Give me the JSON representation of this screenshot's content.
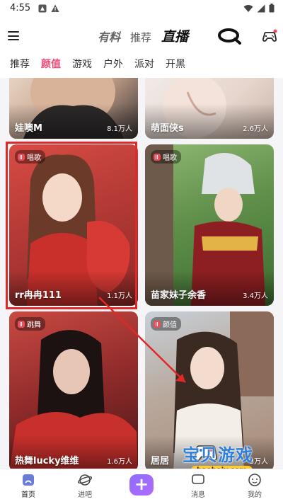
{
  "status_bar": {
    "time": "4:55"
  },
  "header": {
    "tabs": [
      {
        "label": "有料"
      },
      {
        "label": "推荐"
      },
      {
        "label": "直播"
      }
    ]
  },
  "categories": [
    "推荐",
    "颜值",
    "游戏",
    "户外",
    "派对",
    "开黑"
  ],
  "active_category": "颜值",
  "cards": [
    {
      "name": "娃噢M",
      "views": "8.1万人",
      "tag": ""
    },
    {
      "name": "萌面侠s",
      "views": "2.6万人",
      "tag": ""
    },
    {
      "name": "rr冉冉111",
      "views": "1.1万人",
      "tag": "唱歌"
    },
    {
      "name": "苗家妹子余香",
      "views": "3.4万人",
      "tag": "唱歌"
    },
    {
      "name": "热舞lucky维维",
      "views": "1.6万人",
      "tag": "跳舞"
    },
    {
      "name": "居居",
      "views": "3万人",
      "tag": "颜值"
    }
  ],
  "bottom_nav": {
    "items": [
      {
        "label": "首页"
      },
      {
        "label": "进吧"
      },
      {
        "label": ""
      },
      {
        "label": "消息"
      },
      {
        "label": "我的"
      }
    ]
  },
  "watermark": {
    "title": "宝贝游戏网",
    "url": "baobeiy.com"
  },
  "colors": {
    "accent": "#f24a76",
    "highlight": "#e02828",
    "plus": "#9b6bff"
  }
}
